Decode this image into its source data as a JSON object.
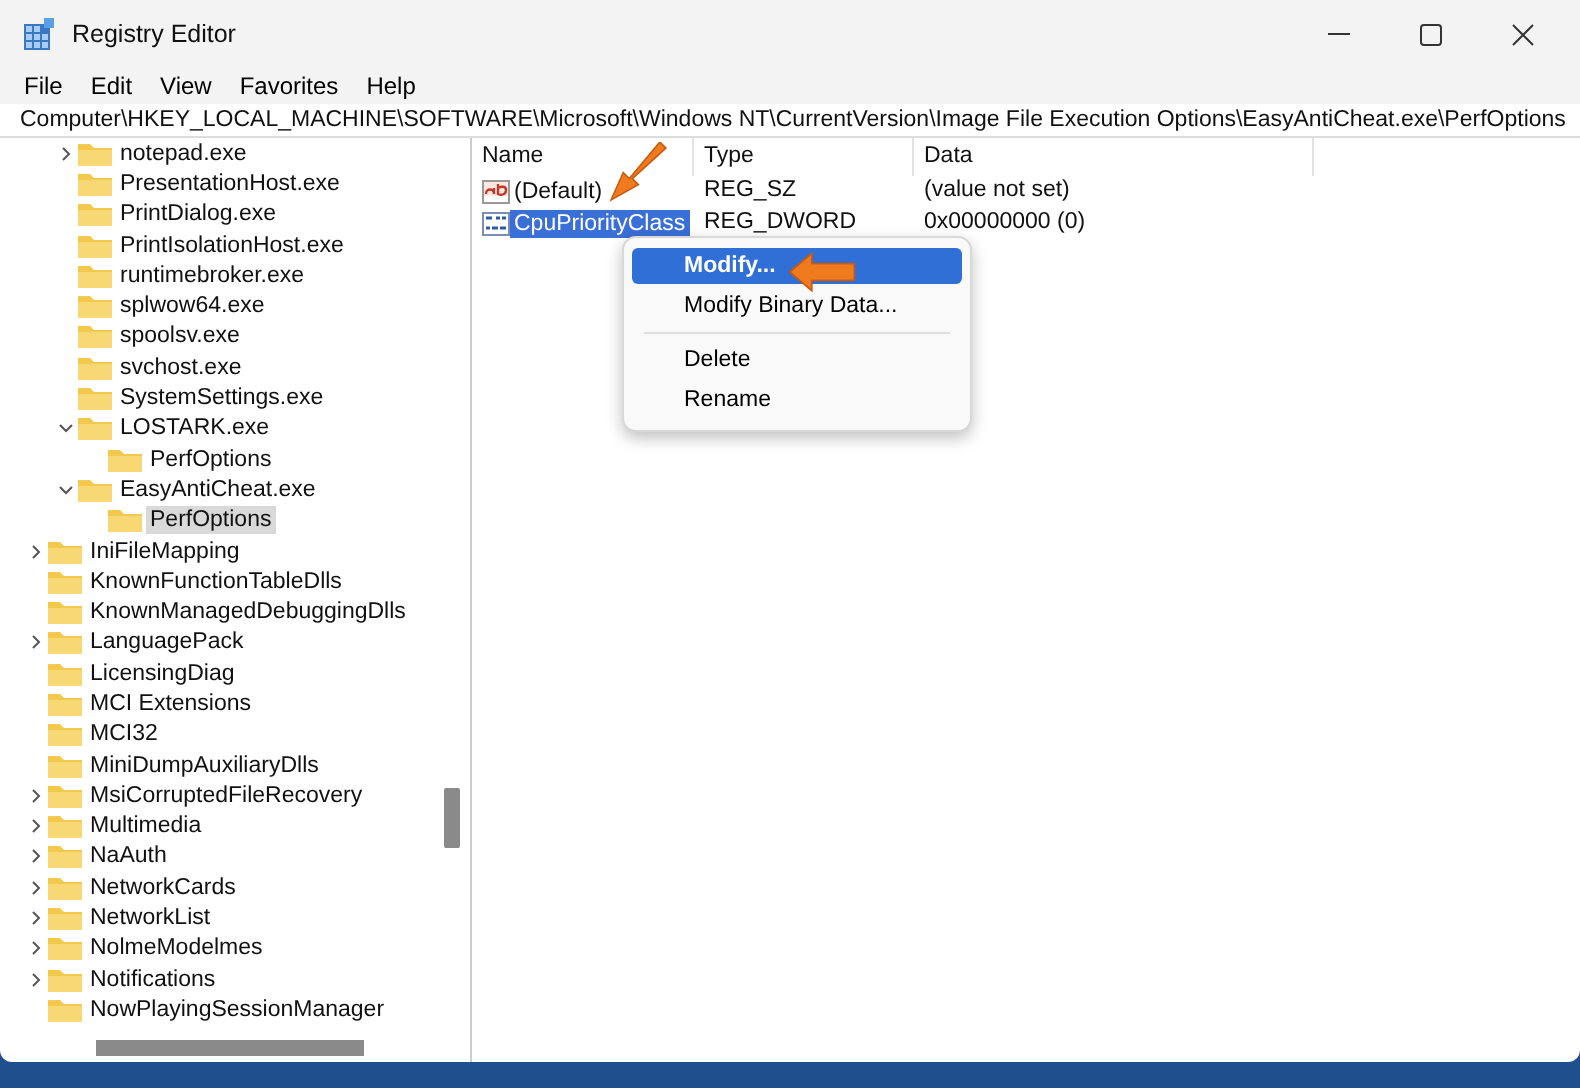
{
  "window": {
    "title": "Registry Editor"
  },
  "menu": [
    "File",
    "Edit",
    "View",
    "Favorites",
    "Help"
  ],
  "address": "Computer\\HKEY_LOCAL_MACHINE\\SOFTWARE\\Microsoft\\Windows NT\\CurrentVersion\\Image File Execution Options\\EasyAntiCheat.exe\\PerfOptions",
  "tree": {
    "partial_branch": [
      {
        "label": "notepad.exe",
        "expanded": false,
        "selected": false
      },
      {
        "label": "PresentationHost.exe",
        "selected": false
      },
      {
        "label": "PrintDialog.exe",
        "selected": false
      },
      {
        "label": "PrintIsolationHost.exe",
        "selected": false
      },
      {
        "label": "runtimebroker.exe",
        "selected": false
      },
      {
        "label": "splwow64.exe",
        "selected": false
      },
      {
        "label": "spoolsv.exe",
        "selected": false
      },
      {
        "label": "svchost.exe",
        "selected": false
      },
      {
        "label": "SystemSettings.exe",
        "selected": false
      },
      {
        "label": "LOSTARK.exe",
        "expanded": true,
        "selected": false,
        "children": [
          {
            "label": "PerfOptions",
            "selected": false
          }
        ]
      },
      {
        "label": "EasyAntiCheat.exe",
        "expanded": true,
        "selected": false,
        "children": [
          {
            "label": "PerfOptions",
            "selected": true
          }
        ]
      }
    ],
    "items": [
      {
        "label": "IniFileMapping",
        "expanded": false,
        "selected": false
      },
      {
        "label": "KnownFunctionTableDlls",
        "selected": false
      },
      {
        "label": "KnownManagedDebuggingDlls",
        "selected": false
      },
      {
        "label": "LanguagePack",
        "expanded": false,
        "selected": false
      },
      {
        "label": "LicensingDiag",
        "selected": false
      },
      {
        "label": "MCI Extensions",
        "selected": false
      },
      {
        "label": "MCI32",
        "selected": false
      },
      {
        "label": "MiniDumpAuxiliaryDlls",
        "selected": false
      },
      {
        "label": "MsiCorruptedFileRecovery",
        "expanded": false,
        "selected": false
      },
      {
        "label": "Multimedia",
        "expanded": false,
        "selected": false
      },
      {
        "label": "NaAuth",
        "expanded": false,
        "selected": false
      },
      {
        "label": "NetworkCards",
        "expanded": false,
        "selected": false
      },
      {
        "label": "NetworkList",
        "expanded": false,
        "selected": false
      },
      {
        "label": "NolmeModelmes",
        "expanded": false,
        "selected": false
      },
      {
        "label": "Notifications",
        "expanded": false,
        "selected": false
      },
      {
        "label": "NowPlayingSessionManager",
        "selected": false
      }
    ]
  },
  "table": {
    "columns": [
      "Name",
      "Type",
      "Data"
    ],
    "rows": [
      {
        "kind": "string",
        "name": "(Default)",
        "type": "REG_SZ",
        "data": "(value not set)",
        "selected": false
      },
      {
        "kind": "dword",
        "name": "CpuPriorityClass",
        "type": "REG_DWORD",
        "data": "0x00000000 (0)",
        "selected": true
      }
    ]
  },
  "context_menu": [
    {
      "kind": "item",
      "label": "Modify...",
      "selected": true
    },
    {
      "kind": "item",
      "label": "Modify Binary Data...",
      "selected": false
    },
    {
      "kind": "separator"
    },
    {
      "kind": "item",
      "label": "Delete",
      "selected": false
    },
    {
      "kind": "item",
      "label": "Rename",
      "selected": false
    }
  ]
}
